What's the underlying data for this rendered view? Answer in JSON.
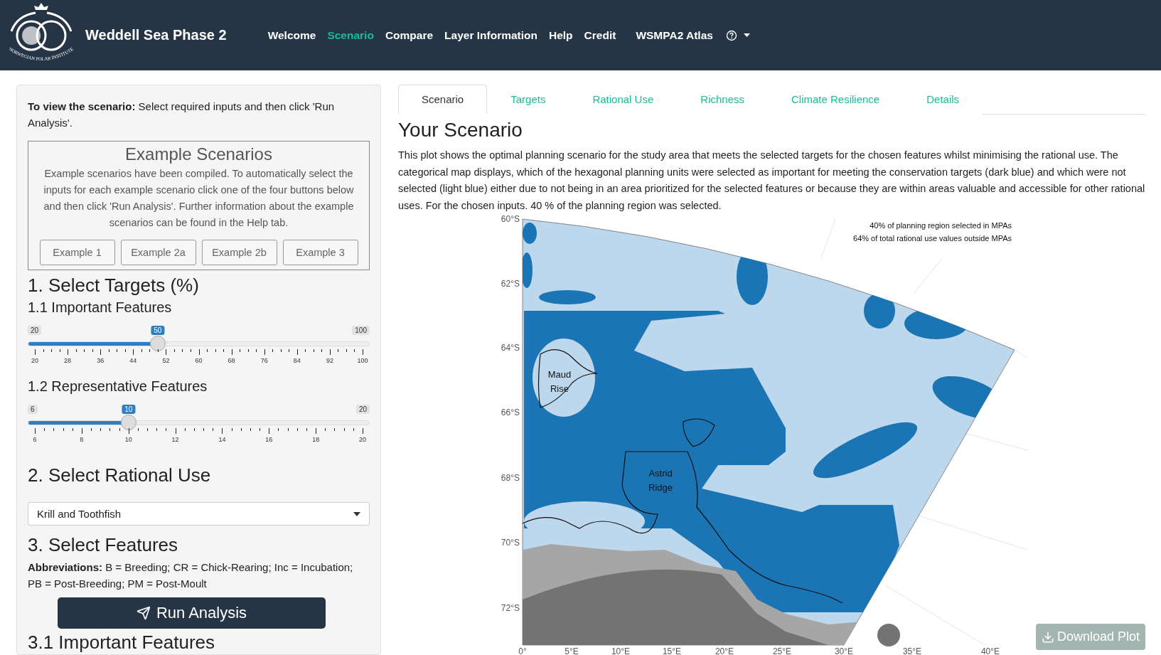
{
  "navbar": {
    "logo_text": "NORWEGIAN POLAR INSTITUTE",
    "title": "Weddell Sea Phase 2",
    "items": [
      {
        "label": "Welcome",
        "selected": false
      },
      {
        "label": "Scenario",
        "selected": true
      },
      {
        "label": "Compare",
        "selected": false
      },
      {
        "label": "Layer Information",
        "selected": false
      },
      {
        "label": "Help",
        "selected": false
      },
      {
        "label": "Credit",
        "selected": false
      }
    ],
    "atlas": "WSMPA2 Atlas"
  },
  "sidebar": {
    "intro": "**To view the scenario:** Select required inputs and then click 'Run Analysis'.",
    "examples": {
      "title": "Example Scenarios",
      "text": "Example scenarios have been compiled. To automatically select the inputs for each example scenario click one of the four buttons below and then click 'Run Analysis'. Further information about the example scenarios can be found in the Help tab.",
      "buttons": [
        "Example 1",
        "Example 2a",
        "Example 2b",
        "Example 3"
      ]
    },
    "targets_heading": "1. Select Targets (%)",
    "sliders": [
      {
        "heading": "1.1 Important Features",
        "min": "20",
        "max": "100",
        "value": "50",
        "level": 0.375,
        "ticks": [
          "20",
          "28",
          "36",
          "44",
          "52",
          "60",
          "68",
          "76",
          "84",
          "92",
          "100"
        ]
      },
      {
        "heading": "1.2 Representative Features",
        "min": "6",
        "max": "20",
        "value": "10",
        "level": 0.286,
        "ticks": [
          "6",
          "8",
          "10",
          "12",
          "14",
          "16",
          "18",
          "20"
        ]
      }
    ],
    "rational_heading": "2. Select Rational Use",
    "rational_select": "Krill and Toothfish",
    "features_heading": "3. Select Features",
    "abbreviations": "**Abbreviations:** B = Breeding; CR = Chick-Rearing; Inc = Incubation; PB = Post-Breeding; PM = Post-Moult",
    "run_button": "Run Analysis",
    "subheading": "3.1 Important Features"
  },
  "tabs": [
    {
      "label": "Scenario",
      "selected": true
    },
    {
      "label": "Targets",
      "selected": false
    },
    {
      "label": "Rational Use",
      "selected": false
    },
    {
      "label": "Richness",
      "selected": false
    },
    {
      "label": "Climate Resilience",
      "selected": false
    },
    {
      "label": "Details",
      "selected": false
    }
  ],
  "scenario": {
    "title": "Your Scenario",
    "description": "This plot shows the optimal planning scenario for the study area that meets the selected targets for the chosen features whilst minimising the rational use. The categorical map displays, which of the hexagonal planning units were selected as important for meeting the conservation targets (dark blue) and which were not selected (light blue) either due to not being in an area prioritized for the selected features or because they are within areas valuable and accessible for other rational uses. For the chosen inputs. 40 % of the planning region was selected.",
    "map": {
      "annotations": [
        "40% of planning region selected in MPAs",
        "64% of total rational use values outside MPAs"
      ],
      "lat_labels": [
        "60°S",
        "62°S",
        "64°S",
        "66°S",
        "68°S",
        "70°S",
        "72°S"
      ],
      "lon_labels": [
        "0°",
        "5°E",
        "10°E",
        "15°E",
        "20°E",
        "25°E",
        "30°E",
        "35°E",
        "40°E"
      ],
      "places": [
        [
          "Maud",
          "Rise"
        ],
        [
          "Astrid",
          "Ridge"
        ]
      ]
    },
    "download_button": "Download Plot"
  }
}
